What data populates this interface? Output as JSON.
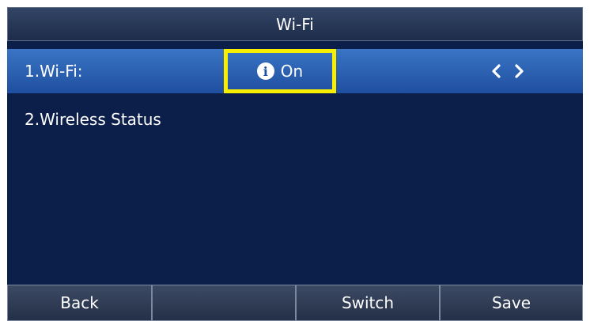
{
  "title": "Wi-Fi",
  "menu": {
    "items": [
      {
        "label": "1.Wi-Fi:",
        "value": "On",
        "info_icon": "info-icon",
        "arrows": [
          "chevron-left-icon",
          "chevron-right-icon"
        ]
      },
      {
        "label": "2.Wireless Status"
      }
    ]
  },
  "softkeys": {
    "labels": [
      "Back",
      "",
      "Switch",
      "Save"
    ]
  },
  "colors": {
    "screen_bg": "#0b1f4a",
    "selected_row": "#2a62b4",
    "highlight_box": "#f7ee00"
  }
}
